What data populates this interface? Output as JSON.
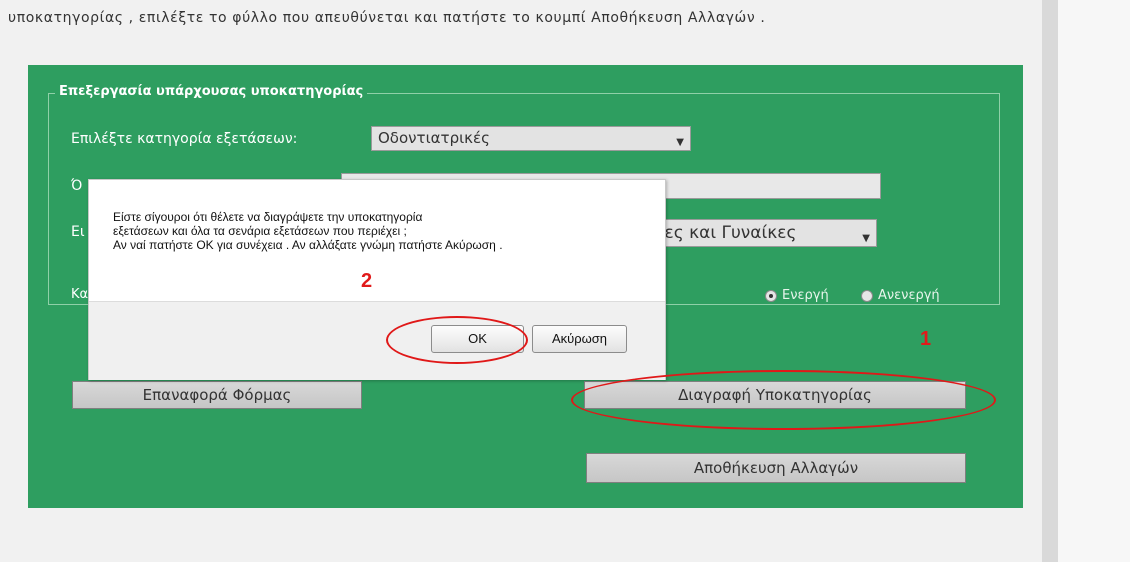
{
  "instruction_text": "υποκατηγορίας , επιλέξτε το φύλλο που απευθύνεται και πατήστε το κουμπί Αποθήκευση Αλλαγών .",
  "form": {
    "legend": "Επεξεργασία υπάρχουσας υποκατηγορίας",
    "category_label": "Επιλέξτε κατηγορία εξετάσεων:",
    "category_value": "Οδοντιατρικές",
    "name_label_fragment": "Ό",
    "gender_label_fragment": "Ει",
    "gender_value": "ντρες και Γυναίκες",
    "status_label_fragment": "Κα",
    "status_active": "Ενεργή",
    "status_inactive": "Ανενεργή",
    "reset_button": "Επαναφορά Φόρμας",
    "delete_button": "Διαγραφή Υποκατηγορίας",
    "save_button": "Αποθήκευση Αλλαγών"
  },
  "dialog": {
    "line1": "Είστε σίγουροι ότι θέλετε να διαγράψετε την υποκατηγορία",
    "line2": "εξετάσεων και όλα τα σενάρια εξετάσεων που περιέχει ;",
    "line3": "Αν ναί πατήστε OK για συνέχεια . Αν αλλάξατε γνώμη πατήστε Ακύρωση .",
    "ok_label": "OK",
    "cancel_label": "Ακύρωση"
  },
  "annotations": {
    "step1": "1",
    "step2": "2",
    "color": "#e01818"
  },
  "colors": {
    "panel_green": "#2e9e60"
  }
}
